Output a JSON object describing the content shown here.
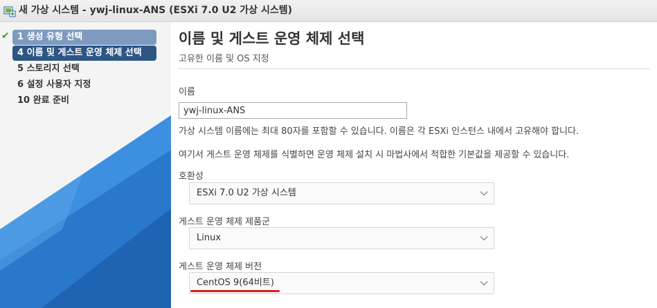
{
  "window": {
    "title": "새 가상 시스템 - ywj-linux-ANS (ESXi 7.0 U2 가상 시스템)",
    "icon": "vm-icon"
  },
  "sidebar": {
    "steps": [
      {
        "label": "1 생성 유형 선택",
        "state": "done"
      },
      {
        "label": "4 이름 및 게스트 운영 체제 선택",
        "state": "active"
      },
      {
        "label": "5 스토리지 선택",
        "state": "pending"
      },
      {
        "label": "6 설정 사용자 지정",
        "state": "pending"
      },
      {
        "label": "10 완료 준비",
        "state": "pending"
      }
    ],
    "check_glyph": "✔"
  },
  "main": {
    "title": "이름 및 게스트 운영 체제 선택",
    "subtitle": "고유한 이름 및 OS 지정",
    "name_label": "이름",
    "name_value": "ywj-linux-ANS",
    "name_help": "가상 시스템 이름에는 최대 80자를 포함할 수 있습니다. 이름은 각 ESXi 인스턴스 내에서 고유해야 합니다.",
    "os_help": "여기서 게스트 운영 체제를 식별하면 운영 체제 설치 시 마법사에서 적합한 기본값을 제공할 수 있습니다.",
    "compat_label": "호환성",
    "compat_value": "ESXi 7.0 U2 가상 시스템",
    "family_label": "게스트 운영 체제 제품군",
    "family_value": "Linux",
    "version_label": "게스트 운영 체제 버전",
    "version_value": "CentOS 9(64비트)"
  },
  "colors": {
    "active_step": "#2d5685",
    "done_step": "#7e9bbf",
    "check": "#3a9a35",
    "sidebar_blue": "#2f7fd0",
    "annotation_underline": "#d91e1e"
  }
}
